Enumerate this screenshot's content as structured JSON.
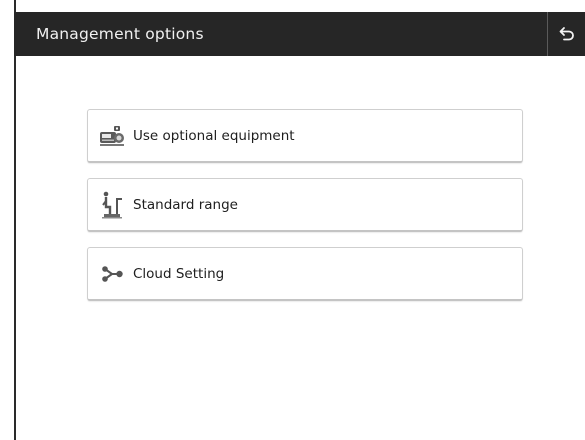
{
  "header": {
    "title": "Management options",
    "back_icon": "back-arrow-icon"
  },
  "options": [
    {
      "label": "Use optional equipment",
      "icon": "optional-equipment-icon"
    },
    {
      "label": "Standard range",
      "icon": "standard-range-icon"
    },
    {
      "label": "Cloud Setting",
      "icon": "cloud-share-icon"
    }
  ],
  "colors": {
    "titlebar_bg": "#262626",
    "titlebar_text": "#f0f0f0",
    "button_border": "#cfcfcf",
    "icon_color": "#555555"
  }
}
